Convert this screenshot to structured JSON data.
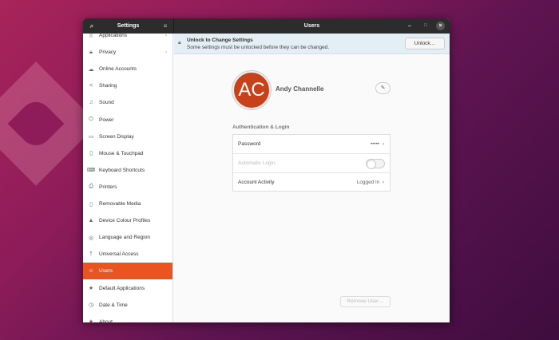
{
  "header": {
    "sidebar_title": "Settings",
    "title": "Users"
  },
  "sidebar": {
    "items": [
      {
        "label": "Applications",
        "icon": "grid-icon",
        "chevron": true
      },
      {
        "label": "Privacy",
        "icon": "lock-icon",
        "chevron": true
      },
      {
        "label": "Online Accounts",
        "icon": "cloud-icon"
      },
      {
        "label": "Sharing",
        "icon": "share-icon"
      },
      {
        "label": "Sound",
        "icon": "music-note-icon"
      },
      {
        "label": "Power",
        "icon": "power-icon"
      },
      {
        "label": "Screen Display",
        "icon": "display-icon"
      },
      {
        "label": "Mouse & Touchpad",
        "icon": "mouse-icon"
      },
      {
        "label": "Keyboard Shortcuts",
        "icon": "keyboard-icon"
      },
      {
        "label": "Printers",
        "icon": "printer-icon"
      },
      {
        "label": "Removable Media",
        "icon": "media-icon"
      },
      {
        "label": "Device Colour Profiles",
        "icon": "color-profile-icon"
      },
      {
        "label": "Language and Region",
        "icon": "globe-icon"
      },
      {
        "label": "Universal Access",
        "icon": "accessibility-icon"
      },
      {
        "label": "Users",
        "icon": "user-icon",
        "selected": true
      },
      {
        "label": "Default Applications",
        "icon": "star-icon"
      },
      {
        "label": "Date & Time",
        "icon": "clock-icon"
      },
      {
        "label": "About",
        "icon": "star-icon"
      }
    ]
  },
  "unlock_bar": {
    "title": "Unlock to Change Settings",
    "subtitle": "Some settings must be unlocked before they can be changed.",
    "button": "Unlock…"
  },
  "user": {
    "initials": "AC",
    "name": "Andy Channelle",
    "avatar_color": "#c7421a"
  },
  "auth": {
    "section_title": "Authentication & Login",
    "password_label": "Password",
    "password_value": "•••••",
    "auto_login_label": "Automatic Login",
    "auto_login_on": false,
    "activity_label": "Account Activity",
    "activity_value": "Logged in"
  },
  "remove_button": "Remove User…",
  "accent": "#e95420"
}
